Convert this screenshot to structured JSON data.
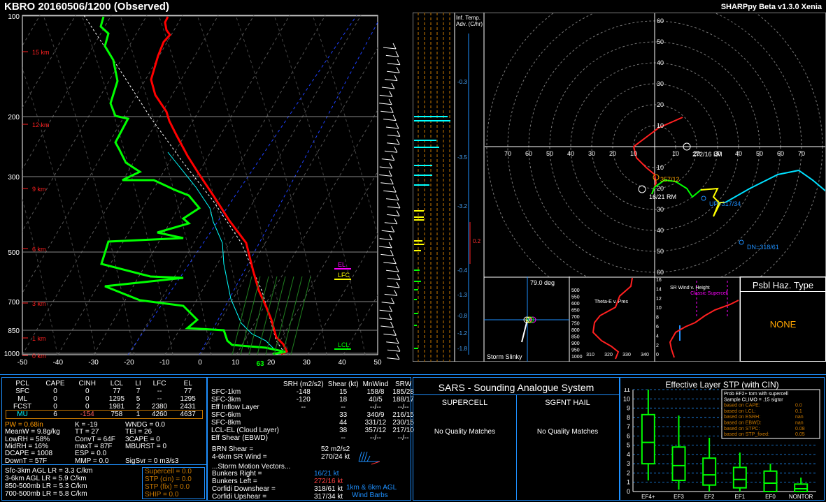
{
  "header": {
    "title": "KBRO   20160506/1200   (Observed)",
    "version": "SHARPpy Beta v1.3.0 Xenia"
  },
  "skewt": {
    "pressure_labels": [
      "100",
      "200",
      "300",
      "500",
      "700",
      "850",
      "1000"
    ],
    "temp_labels": [
      "-50",
      "-40",
      "-30",
      "-20",
      "-10",
      "0",
      "10",
      "20",
      "30",
      "40",
      "50"
    ],
    "height_labels": [
      "15 km",
      "12 km",
      "9 km",
      "6 km",
      "3 km",
      "1 km",
      "0 km"
    ],
    "parcel_levels": [
      "EL",
      "LFC",
      "LCL"
    ],
    "sfc_temp_label": "63",
    "colors": {
      "temp": "#ff0000",
      "dewp": "#00ff00",
      "virtual": "#ff3b3b",
      "wetbulb": "#00ffff",
      "parcel": "#ffffff"
    }
  },
  "inferred_temp_adv": {
    "title_line1": "Inf. Temp.",
    "title_line2": "Adv. (C/hr)",
    "values": [
      "-0.3",
      "-3.5",
      "-3.2",
      "0.2",
      "-0.4",
      "-1.3",
      "-0.8",
      "-1.2",
      "-1.8"
    ]
  },
  "hodograph": {
    "ring_labels_vertical": [
      "60",
      "50",
      "40",
      "30",
      "20",
      "10",
      "10",
      "20",
      "30",
      "40",
      "50",
      "60"
    ],
    "ring_labels_horizontal": [
      "70",
      "60",
      "50",
      "40",
      "30",
      "20",
      "10",
      "10",
      "20",
      "30",
      "40",
      "50",
      "60",
      "70"
    ],
    "annotations": {
      "lm": "272/16 LM",
      "rm": "16/21 RM",
      "mean": "357/12",
      "up": "UP=317/34",
      "dn": "DN=318/61"
    }
  },
  "storm_slinky": {
    "label": "Storm Slinky",
    "angle": "79.0 deg"
  },
  "theta_e": {
    "title": "Theta-E v. Pres",
    "pres_labels": [
      "500",
      "550",
      "600",
      "650",
      "700",
      "750",
      "800",
      "850",
      "900",
      "950",
      "1000"
    ],
    "theta_labels": [
      "310",
      "320",
      "330",
      "340"
    ]
  },
  "srwind": {
    "title": "SR Wind v. Height",
    "classic": "Classic Supercell",
    "height_labels": [
      "16",
      "14",
      "12",
      "10",
      "8",
      "6",
      "4",
      "2",
      "0"
    ]
  },
  "hazard": {
    "title": "Psbl Haz. Type",
    "value": "NONE"
  },
  "thermo": {
    "headers": [
      "PCL",
      "CAPE",
      "CINH",
      "LCL",
      "LI",
      "LFC",
      "EL"
    ],
    "rows": [
      [
        "SFC",
        "0",
        "0",
        "77",
        "7",
        "--",
        "77"
      ],
      [
        "ML",
        "0",
        "0",
        "1295",
        "5",
        "--",
        "1295"
      ],
      [
        "FCST",
        "0",
        "0",
        "1981",
        "2",
        "2380",
        "2431"
      ],
      [
        "MU",
        "6",
        "-154",
        "758",
        "1",
        "4260",
        "4637"
      ]
    ],
    "indices_col1": [
      "PW = 0.68in",
      "MeanW = 9.8g/kg",
      "LowRH = 58%",
      "MidRH = 16%",
      "DCAPE = 1008",
      "DownT = 57F"
    ],
    "indices_col2": [
      "K = -19",
      "TT = 27",
      "ConvT = 64F",
      "maxT = 87F",
      "ESP = 0.0",
      "MMP = 0.0"
    ],
    "indices_col3": [
      "WNDG = 0.0",
      "TEI = 26",
      "3CAPE = 0",
      "MBURST = 0",
      "",
      "SigSvr = 0 m3/s3"
    ],
    "lapse": [
      "Sfc-3km AGL LR = 3.3 C/km",
      "3-6km AGL LR = 5.9 C/km",
      "850-500mb LR = 5.3 C/km",
      "700-500mb LR = 5.8 C/km"
    ],
    "composite": [
      "Supercell = 0.0",
      "STP (cin) = 0.0",
      "STP (fix) = 0.0",
      "SHIP = 0.0"
    ]
  },
  "kinematics": {
    "headers": [
      "",
      "SRH (m2/s2)",
      "Shear (kt)",
      "MnWind",
      "SRW"
    ],
    "rows": [
      [
        "SFC-1km",
        "-148",
        "15",
        "158/8",
        "185/28"
      ],
      [
        "SFC-3km",
        "-120",
        "18",
        "40/5",
        "188/17"
      ],
      [
        "Eff Inflow Layer",
        "--",
        "--",
        "--/--",
        "--/--"
      ],
      [
        "",
        "",
        " ",
        "",
        ""
      ],
      [
        "SFC-6km",
        "",
        "33",
        "340/9",
        "216/15"
      ],
      [
        "SFC-8km",
        "",
        "44",
        "331/12",
        "230/15"
      ],
      [
        "LCL-EL (Cloud Layer)",
        "",
        "38",
        "357/12",
        "217/10"
      ],
      [
        "Eff Shear (EBWD)",
        "",
        "--",
        "--/--",
        "--/--"
      ]
    ],
    "brn_label": "BRN Shear =",
    "brn_value": "52 m2/s2",
    "wind46_label": "4-6km SR Wind =",
    "wind46_value": "270/24 kt",
    "storm_motion": "...Storm Motion Vectors...",
    "vectors": [
      {
        "label": "Bunkers Right =",
        "value": "16/21 kt"
      },
      {
        "label": "Bunkers Left =",
        "value": "272/16 kt"
      },
      {
        "label": "Corfidi Downshear =",
        "value": "318/61 kt"
      },
      {
        "label": "Corfidi Upshear =",
        "value": "317/34 kt"
      }
    ],
    "agl_line1": "1km & 6km AGL",
    "agl_line2": "Wind Barbs"
  },
  "sars": {
    "title": "SARS - Sounding Analogue System",
    "supercell": "SUPERCELL",
    "hail": "SGFNT HAIL",
    "supercell_result": "No Quality Matches",
    "hail_result": "No Quality Matches"
  },
  "stp_chart": {
    "title": "Effective Layer STP (with CIN)",
    "legend": [
      {
        "label": "Prob EF2+ torn with supercell",
        "value": ""
      },
      {
        "label": "Sample CLIMO = .15 sigtor",
        "value": ""
      },
      {
        "label": "based on CAPE:",
        "value": "0.0"
      },
      {
        "label": "based on LCL:",
        "value": "0.1"
      },
      {
        "label": "based on ESRH:",
        "value": "nan"
      },
      {
        "label": "based on EBWD:",
        "value": "nan"
      },
      {
        "label": "based on STPC:",
        "value": "0.08"
      },
      {
        "label": "based on STP_fixed:",
        "value": "0.05"
      }
    ],
    "y_ticks": [
      "11",
      "10",
      "9",
      "8",
      "7",
      "6",
      "5",
      "4",
      "3",
      "2",
      "1",
      "0"
    ],
    "categories": [
      "EF4+",
      "EF3",
      "EF2",
      "EF1",
      "EF0",
      "NONTOR"
    ]
  },
  "chart_data": {
    "type": "box",
    "title": "Effective Layer STP (with CIN)",
    "categories": [
      "EF4+",
      "EF3",
      "EF2",
      "EF1",
      "EF0",
      "NONTOR"
    ],
    "ylim": [
      0,
      11
    ],
    "boxes": [
      {
        "whisker_low": 1.2,
        "q1": 3.0,
        "median": 5.3,
        "q3": 8.3,
        "whisker_high": 11.0
      },
      {
        "whisker_low": 0.2,
        "q1": 1.2,
        "median": 2.8,
        "q3": 4.8,
        "whisker_high": 8.2
      },
      {
        "whisker_low": 0.0,
        "q1": 0.7,
        "median": 1.8,
        "q3": 3.6,
        "whisker_high": 5.8
      },
      {
        "whisker_low": 0.0,
        "q1": 0.4,
        "median": 1.3,
        "q3": 2.6,
        "whisker_high": 4.2
      },
      {
        "whisker_low": 0.0,
        "q1": 0.0,
        "median": 0.9,
        "q3": 2.2,
        "whisker_high": 3.0
      },
      {
        "whisker_low": 0.0,
        "q1": 0.0,
        "median": 0.3,
        "q3": 0.8,
        "whisker_high": 1.5
      }
    ]
  }
}
